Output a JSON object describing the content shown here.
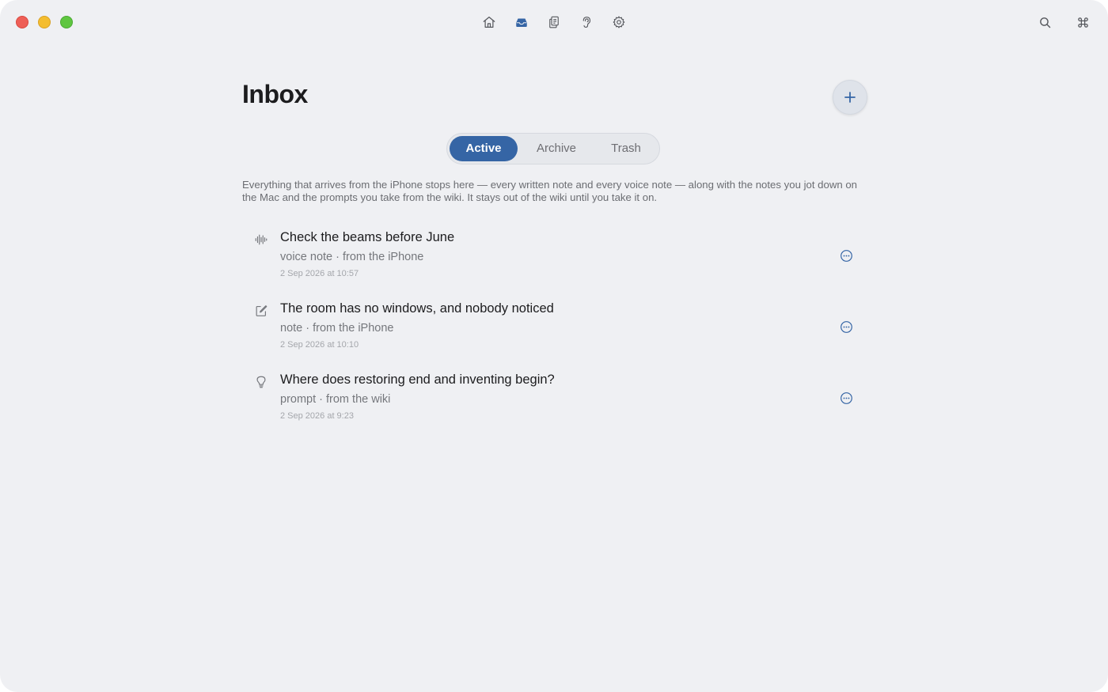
{
  "window": {
    "controls": [
      "close",
      "minimize",
      "maximize"
    ]
  },
  "toolbar": {
    "icons": [
      "house-icon",
      "inbox-tray-icon",
      "documents-icon",
      "ear-icon",
      "gear-icon"
    ],
    "right_icons": [
      "search-icon",
      "command-icon"
    ],
    "active": "inbox-tray-icon"
  },
  "page": {
    "title": "Inbox",
    "add_label": "+"
  },
  "tabs": [
    {
      "label": "Active",
      "selected": true
    },
    {
      "label": "Archive",
      "selected": false
    },
    {
      "label": "Trash",
      "selected": false
    }
  ],
  "description": "Everything that arrives from the iPhone stops here — every written note and every voice note — along with the notes you jot down on the Mac and the prompts you take from the wiki. It stays out of the wiki until you take it on.",
  "items": [
    {
      "icon": "waveform-icon",
      "title": "Check the beams before June",
      "meta": "voice note · from the iPhone",
      "date": "2 Sep 2026 at 10:57"
    },
    {
      "icon": "compose-icon",
      "title": "The room has no windows, and nobody noticed",
      "meta": "note · from the iPhone",
      "date": "2 Sep 2026 at 10:10"
    },
    {
      "icon": "lightbulb-icon",
      "title": "Where does restoring end and inventing begin?",
      "meta": "prompt · from the wiki",
      "date": "2 Sep 2026 at 9:23"
    }
  ],
  "colors": {
    "background": "#eff0f3",
    "accent": "#3565a5",
    "text_primary": "#1c1c1e",
    "text_secondary": "#75777c",
    "text_tertiary": "#a4a6ab"
  }
}
